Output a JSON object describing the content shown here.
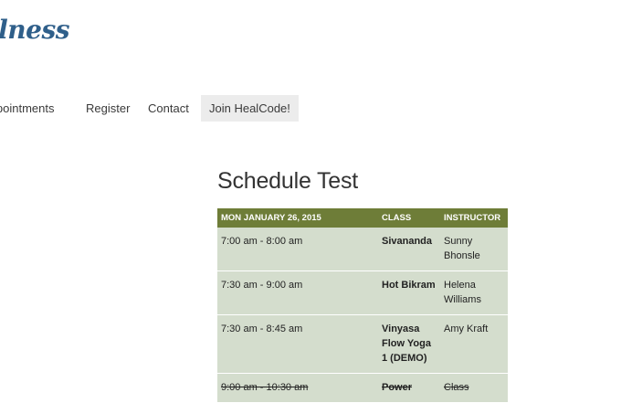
{
  "site": {
    "logo_text": "llness"
  },
  "nav": {
    "items": [
      "Appointments",
      "Register",
      "Contact",
      "Join HealCode!"
    ]
  },
  "page": {
    "title": "Schedule Test"
  },
  "schedule": {
    "headers": {
      "date": "MON JANUARY 26, 2015",
      "class": "CLASS",
      "instructor": "INSTRUCTOR"
    },
    "rows": [
      {
        "time": "7:00 am - 8:00 am",
        "class": "Sivananda",
        "instructor": "Sunny Bhonsle",
        "cancelled": false
      },
      {
        "time": "7:30 am - 9:00 am",
        "class": "Hot Bikram",
        "instructor": "Helena Williams",
        "cancelled": false
      },
      {
        "time": "7:30 am - 8:45 am",
        "class": "Vinyasa Flow Yoga 1 (DEMO)",
        "instructor": "Amy Kraft",
        "cancelled": false
      },
      {
        "time": "9:00 am - 10:30 am",
        "class": "Power",
        "instructor": "Class",
        "cancelled": true
      }
    ]
  },
  "colors": {
    "logo": "#2f5f8a",
    "table_header_bg": "#6e7d38",
    "table_row_bg": "#d4ddcd",
    "nav_highlight_bg": "#ececec"
  }
}
